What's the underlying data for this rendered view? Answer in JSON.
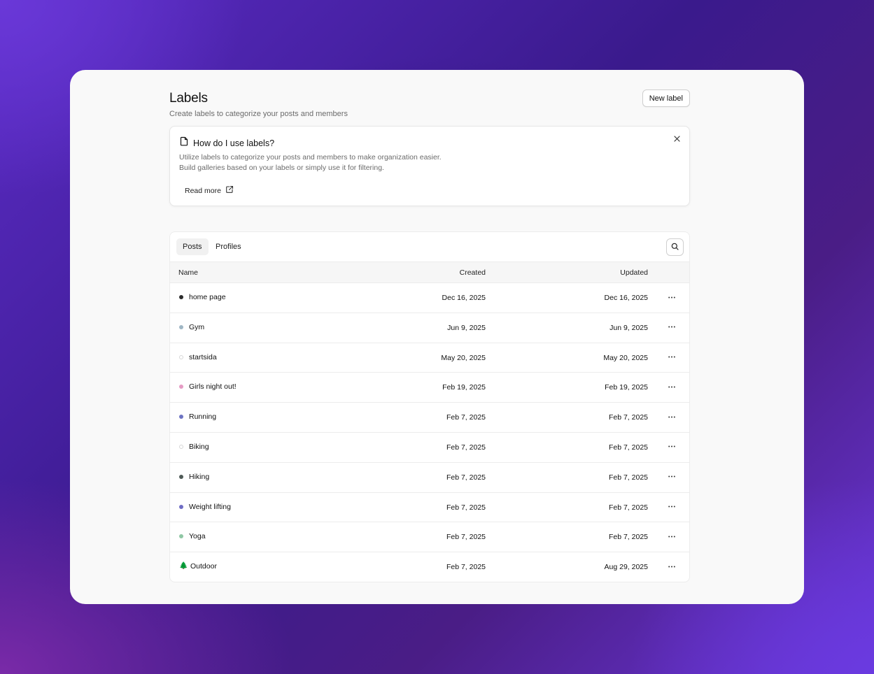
{
  "header": {
    "title": "Labels",
    "subtitle": "Create labels to categorize your posts and members",
    "new_label_button": "New label"
  },
  "info_card": {
    "title": "How do I use labels?",
    "body": "Utilize labels to categorize your posts and members to make organization easier. Build galleries based on your labels or simply use it for filtering.",
    "read_more": "Read more",
    "icon": "document-icon"
  },
  "tabs": [
    {
      "label": "Posts",
      "active": true
    },
    {
      "label": "Profiles",
      "active": false
    }
  ],
  "table": {
    "columns": {
      "name": "Name",
      "created": "Created",
      "updated": "Updated"
    },
    "rows": [
      {
        "name": "home page",
        "color": "#2b2b2b",
        "created": "Dec 16, 2025",
        "updated": "Dec 16, 2025"
      },
      {
        "name": "Gym",
        "color": "#9fb6c4",
        "created": "Jun 9, 2025",
        "updated": "Jun 9, 2025"
      },
      {
        "name": "startsida",
        "color": "outline",
        "created": "May 20, 2025",
        "updated": "May 20, 2025"
      },
      {
        "name": "Girls night out!",
        "color": "#e59bc4",
        "created": "Feb 19, 2025",
        "updated": "Feb 19, 2025"
      },
      {
        "name": "Running",
        "color": "#6d73c2",
        "created": "Feb 7, 2025",
        "updated": "Feb 7, 2025"
      },
      {
        "name": "Biking",
        "color": "outline",
        "created": "Feb 7, 2025",
        "updated": "Feb 7, 2025"
      },
      {
        "name": "Hiking",
        "color": "#4e5a56",
        "created": "Feb 7, 2025",
        "updated": "Feb 7, 2025"
      },
      {
        "name": "Weight lifting",
        "color": "#6f6cc4",
        "created": "Feb 7, 2025",
        "updated": "Feb 7, 2025"
      },
      {
        "name": "Yoga",
        "color": "#8fc7a4",
        "created": "Feb 7, 2025",
        "updated": "Feb 7, 2025"
      },
      {
        "name": "Outdoor",
        "color": "emoji",
        "emoji": "🌲",
        "created": "Feb 7, 2025",
        "updated": "Aug 29, 2025"
      }
    ]
  }
}
